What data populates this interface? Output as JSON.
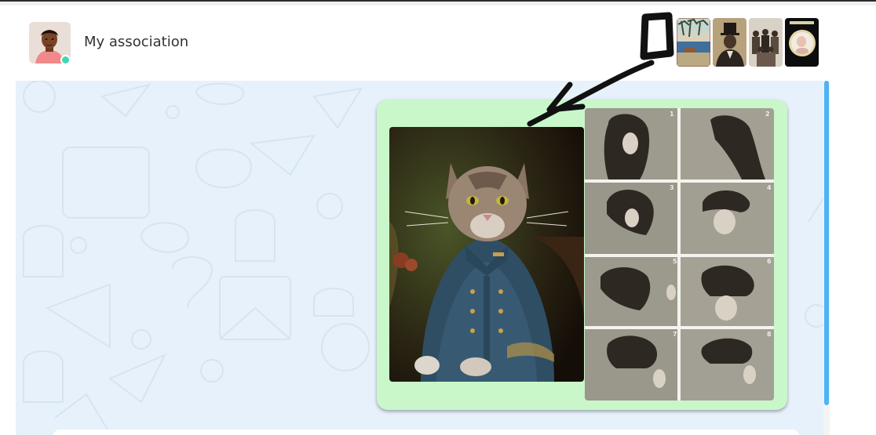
{
  "header": {
    "title": "My association",
    "avatar_icon": "user-avatar",
    "status": "online"
  },
  "shared_media": {
    "count": 4,
    "items": [
      "landscape-print-thumb",
      "top-hat-portrait-thumb",
      "group-photo-thumb",
      "round-portrait-thumb"
    ]
  },
  "message": {
    "images": [
      "cat-in-uniform-painting",
      "hairstyle-steps-photo-grid"
    ],
    "hair_steps": [
      "1",
      "2",
      "3",
      "4",
      "5",
      "6",
      "7",
      "8"
    ]
  },
  "colors": {
    "bubble": "#c9f7ca",
    "chat_background": "#e7f1fb",
    "scrollbar": "#4db3f5",
    "online_dot": "#3fd6b3"
  }
}
